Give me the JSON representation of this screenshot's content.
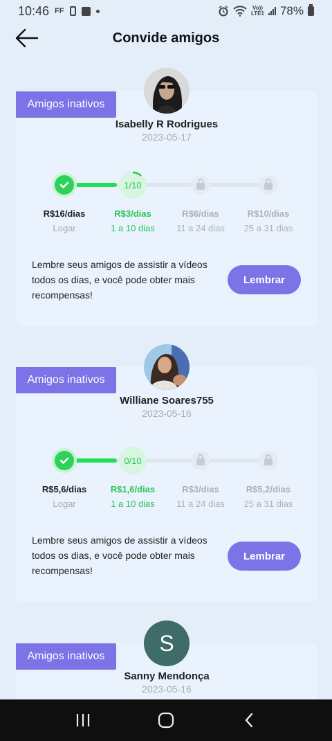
{
  "status": {
    "time": "10:46",
    "ff": "FF",
    "lte_top": "Vo))",
    "lte_bottom": "LTE1",
    "battery": "78%"
  },
  "header": {
    "title": "Convide amigos"
  },
  "colors": {
    "accent": "#7c73e6",
    "green": "#2ec35a",
    "background": "#e4eef9"
  },
  "cards": [
    {
      "tag": "Amigos inativos",
      "name": "Isabelly R Rodrigues",
      "date": "2023-05-17",
      "progress": "1/10",
      "steps": [
        {
          "reward": "R$16/dias",
          "label": "Logar"
        },
        {
          "reward": "R$3/dias",
          "label": "1 a 10 dias"
        },
        {
          "reward": "R$6/dias",
          "label": "11 a 24 dias"
        },
        {
          "reward": "R$10/dias",
          "label": "25 a 31 dias"
        }
      ],
      "message": "Lembre seus amigos de assistir a vídeos todos os dias, e você pode obter mais recompensas!",
      "button": "Lembrar"
    },
    {
      "tag": "Amigos inativos",
      "name": "Williane Soares755",
      "date": "2023-05-16",
      "progress": "0/10",
      "steps": [
        {
          "reward": "R$5,6/dias",
          "label": "Logar"
        },
        {
          "reward": "R$1,6/dias",
          "label": "1 a 10 dias"
        },
        {
          "reward": "R$3/dias",
          "label": "11 a 24 dias"
        },
        {
          "reward": "R$5,2/dias",
          "label": "25 a 31 dias"
        }
      ],
      "message": "Lembre seus amigos de assistir a vídeos todos os dias, e você pode obter mais recompensas!",
      "button": "Lembrar"
    },
    {
      "tag": "Amigos inativos",
      "name": "Sanny Mendonça",
      "date": "2023-05-16",
      "avatar_letter": "S"
    }
  ]
}
